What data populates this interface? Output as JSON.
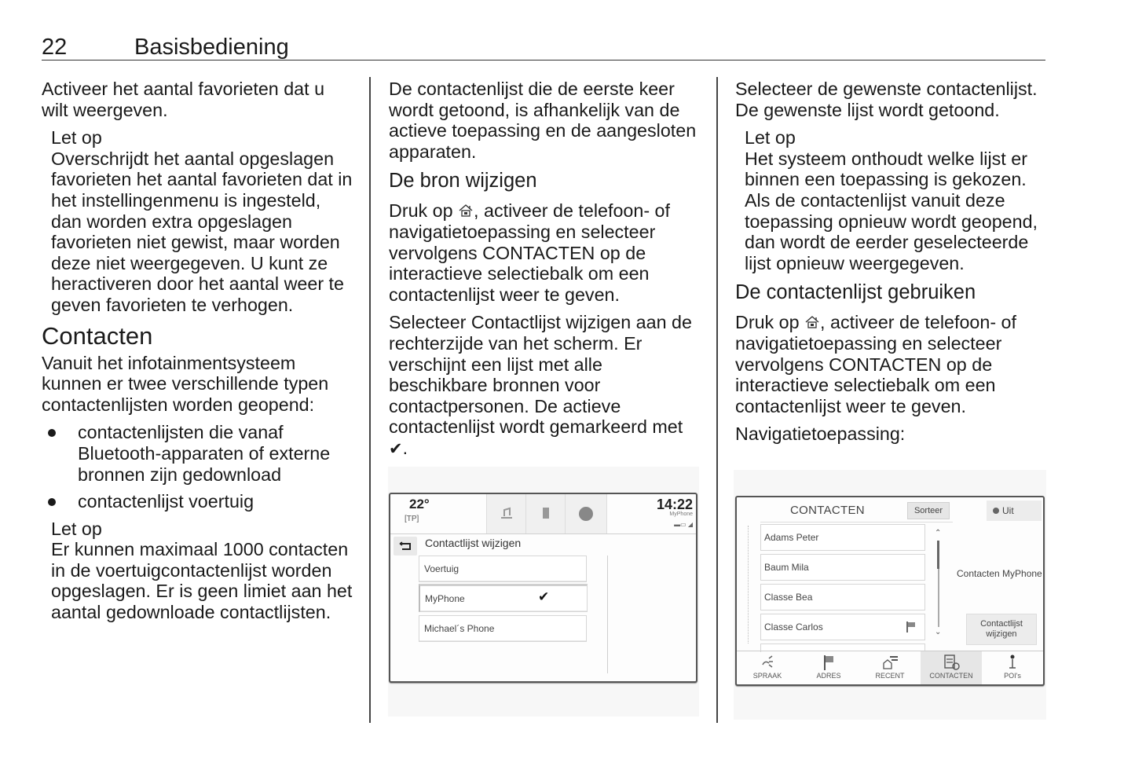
{
  "header": {
    "page_number": "22",
    "title": "Basisbediening"
  },
  "col1": {
    "intro": "Activeer het aantal favorieten dat u wilt weergeven.",
    "note1": {
      "heading": "Let op",
      "text": "Overschrijdt het aantal opgeslagen favorieten het aantal favorieten dat in het instellingenmenu is ingesteld, dan worden extra opgeslagen favorieten niet gewist, maar worden deze niet weergegeven. U kunt ze heractiveren door het aantal weer te geven favorieten te verhogen."
    },
    "section_heading": "Contacten",
    "section_text": "Vanuit het infotainmentsysteem kunnen er twee verschillende typen contactenlijsten worden geopend:",
    "bullets": [
      "contactenlijsten die vanaf Bluetooth-apparaten of externe bronnen zijn gedownload",
      "contactenlijst voertuig"
    ],
    "note2": {
      "heading": "Let op",
      "text": "Er kunnen maximaal 1000 contacten in de voertuigcontactenlijst worden opgeslagen. Er is geen limiet aan het aantal gedownloade contactlijsten."
    }
  },
  "col2": {
    "intro": "De contactenlijst die de eerste keer wordt getoond, is afhankelijk van de actieve toepassing en de aangesloten apparaten.",
    "heading": "De bron wijzigen",
    "p1_pre": "Druk op ",
    "p1_post": ", activeer de telefoon- of navigatietoepassing en selecteer vervolgens ",
    "p1_kw": "CONTACTEN",
    "p1_end": " op de interactieve selectiebalk om een contactenlijst weer te geven.",
    "p2_pre": "Selecteer ",
    "p2_kw": "Contactlijst wijzigen",
    "p2_post": " aan de rechterzijde van het scherm. Er verschijnt een lijst met alle beschikbare bronnen voor contactpersonen. De actieve contactenlijst wordt gemarkeerd met ",
    "p2_check": "✔",
    "p2_end": ".",
    "screen": {
      "temperature": "22°",
      "tp": "[TP]",
      "time": "14:22",
      "phone_name": "MyPhone",
      "title": "Contactlijst wijzigen",
      "sources": [
        {
          "label": "Voertuig",
          "selected": false
        },
        {
          "label": "MyPhone",
          "selected": true
        },
        {
          "label": "Michael´s Phone",
          "selected": false
        }
      ],
      "check": "✔"
    }
  },
  "col3": {
    "intro": "Selecteer de gewenste contactenlijst. De gewenste lijst wordt getoond.",
    "note": {
      "heading": "Let op",
      "text": "Het systeem onthoudt welke lijst er binnen een toepassing is gekozen. Als de contactenlijst vanuit deze toepassing opnieuw wordt geopend, dan wordt de eerder geselecteerde lijst opnieuw weergegeven."
    },
    "heading": "De contactenlijst gebruiken",
    "p1_pre": "Druk op ",
    "p1_post": ", activeer de telefoon- of navigatietoepassing en selecteer vervolgens ",
    "p1_kw": "CONTACTEN",
    "p1_end": " op de interactieve selectiebalk om een contactenlijst weer te geven.",
    "p2": "Navigatietoepassing:",
    "screen": {
      "title": "CONTACTEN",
      "sort_label": "Sorteer",
      "off_label": "Uit",
      "contacts": [
        "Adams Peter",
        "Baum Mila",
        "Classe Bea",
        "Classe Carlos",
        ""
      ],
      "source_label": "Contacten MyPhone",
      "change_list_label": "Contactlijst wijzigen",
      "nav": [
        {
          "label": "SPRAAK",
          "icon": "voice-icon",
          "active": false
        },
        {
          "label": "ADRES",
          "icon": "flag-icon",
          "active": false
        },
        {
          "label": "RECENT",
          "icon": "recent-icon",
          "active": false
        },
        {
          "label": "CONTACTEN",
          "icon": "contacts-icon",
          "active": true
        },
        {
          "label": "POI's",
          "icon": "poi-icon",
          "active": false
        }
      ]
    }
  }
}
